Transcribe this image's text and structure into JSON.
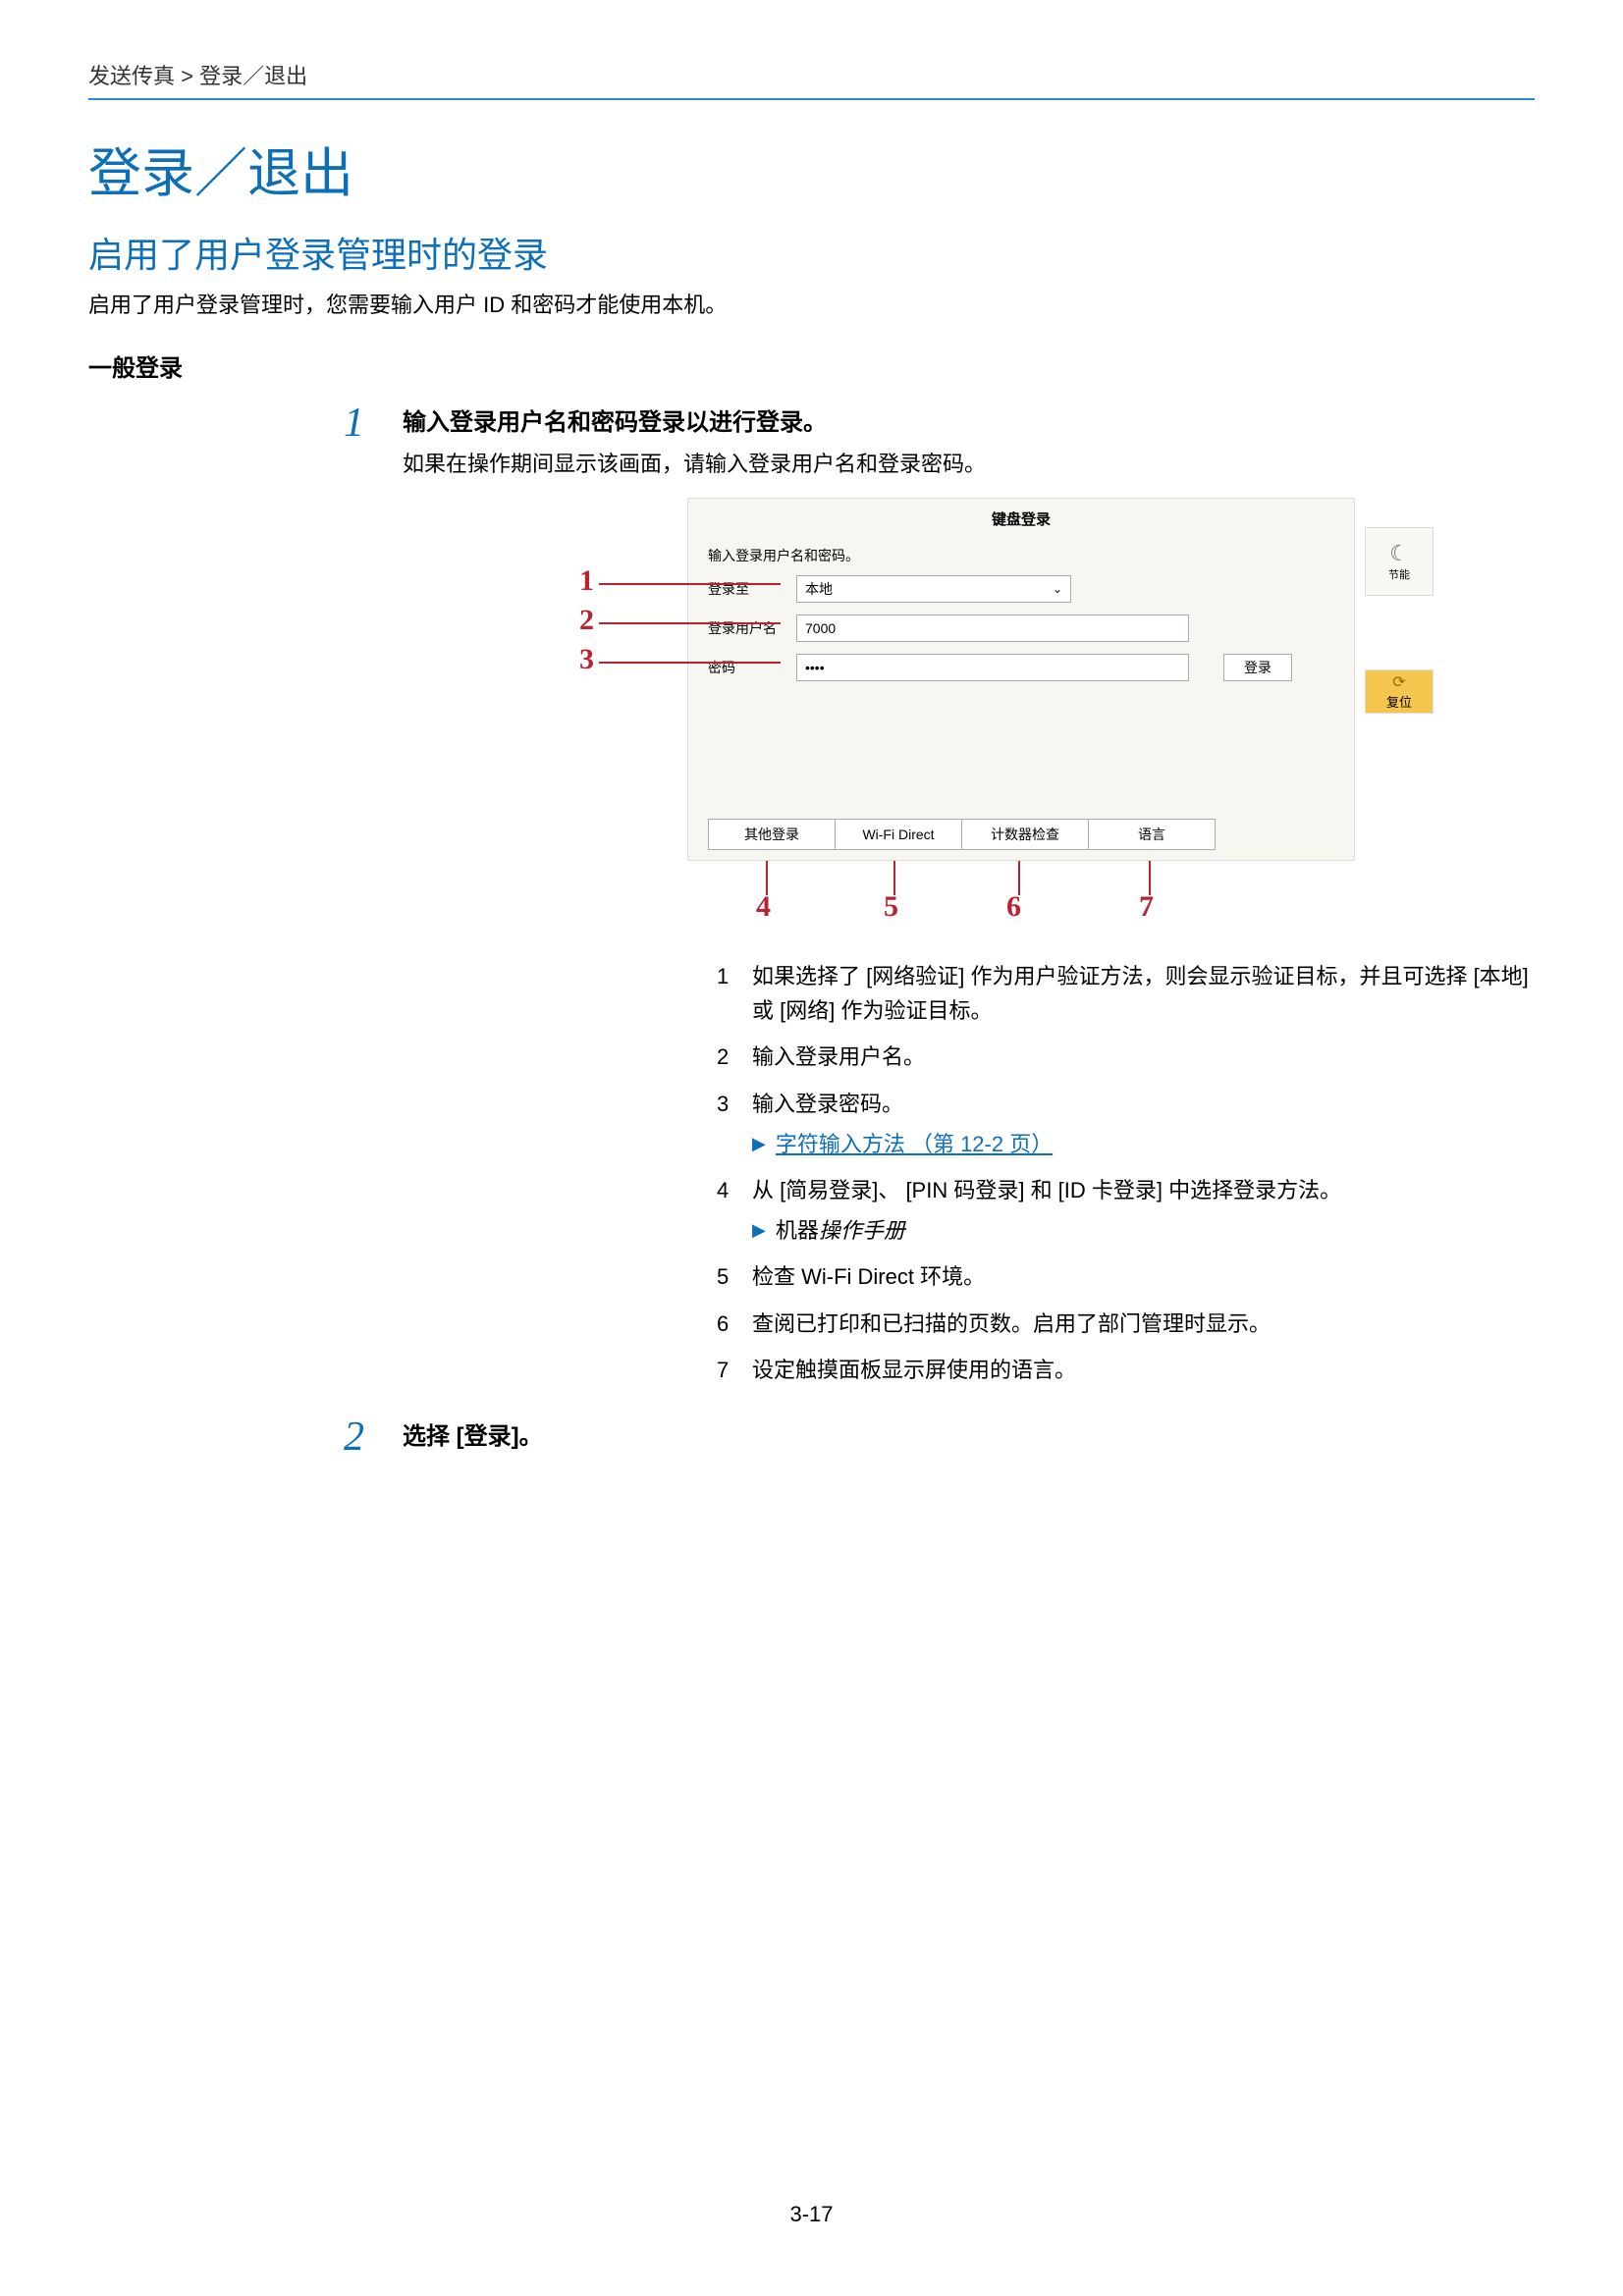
{
  "breadcrumb": "发送传真 > 登录／退出",
  "h1": "登录／退出",
  "h2": "启用了用户登录管理时的登录",
  "intro": "启用了用户登录管理时，您需要输入用户 ID 和密码才能使用本机。",
  "h3": "一般登录",
  "step1": {
    "num": "1",
    "title": "输入登录用户名和密码登录以进行登录。",
    "text": "如果在操作期间显示该画面，请输入登录用户名和登录密码。"
  },
  "screenshot": {
    "kb_login": "键盘登录",
    "prompt": "输入登录用户名和密码。",
    "row1_label": "登录至",
    "row1_value": "本地",
    "row2_label": "登录用户名",
    "row2_value": "7000",
    "row3_label": "密码",
    "row3_value": "••••",
    "login_btn": "登录",
    "tab1": "其他登录",
    "tab2": "Wi-Fi Direct",
    "tab3": "计数器检查",
    "tab4": "语言",
    "side1": "节能",
    "side2": "复位",
    "c1": "1",
    "c2": "2",
    "c3": "3",
    "c4": "4",
    "c5": "5",
    "c6": "6",
    "c7": "7"
  },
  "legend": {
    "i1": "如果选择了 [网络验证] 作为用户验证方法，则会显示验证目标，并且可选择 [本地] 或 [网络] 作为验证目标。",
    "i2": "输入登录用户名。",
    "i3": "输入登录密码。",
    "i3_ref": "字符输入方法 （第 12-2 页）",
    "i4": "从 [简易登录]、 [PIN 码登录] 和 [ID 卡登录] 中选择登录方法。",
    "i4_ref_a": "机器",
    "i4_ref_b": "操作手册",
    "i5": "检查 Wi-Fi Direct 环境。",
    "i6": "查阅已打印和已扫描的页数。启用了部门管理时显示。",
    "i7": "设定触摸面板显示屏使用的语言。"
  },
  "step2": {
    "num": "2",
    "title": "选择 [登录]。"
  },
  "page_num": "3-17"
}
